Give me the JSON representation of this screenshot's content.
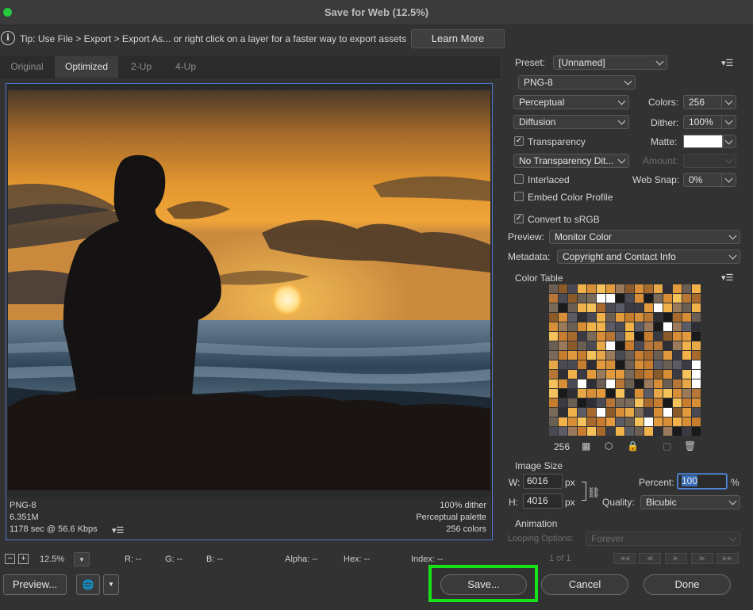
{
  "window": {
    "title": "Save for Web (12.5%)"
  },
  "tip": {
    "text": "Tip: Use File > Export > Export As...  or right click on a layer for a faster way to export assets",
    "learn_more": "Learn More"
  },
  "tabs": [
    "Original",
    "Optimized",
    "2-Up",
    "4-Up"
  ],
  "active_tab": "Optimized",
  "preview_info": {
    "format": "PNG-8",
    "size": "6.351M",
    "time": "1178 sec @ 56.6 Kbps",
    "dither": "100% dither",
    "palette": "Perceptual palette",
    "colors": "256 colors"
  },
  "status": {
    "zoom": "12.5%",
    "r": "R: --",
    "g": "G: --",
    "b": "B: --",
    "alpha": "Alpha: --",
    "hex": "Hex: --",
    "index": "Index: --"
  },
  "buttons": {
    "preview": "Preview...",
    "save": "Save...",
    "cancel": "Cancel",
    "done": "Done"
  },
  "settings": {
    "preset_label": "Preset:",
    "preset_value": "[Unnamed]",
    "format": "PNG-8",
    "reduction": "Perceptual",
    "colors_label": "Colors:",
    "colors_value": "256",
    "dither_algo": "Diffusion",
    "dither_label": "Dither:",
    "dither_value": "100%",
    "transparency_label": "Transparency",
    "transparency_checked": true,
    "matte_label": "Matte:",
    "transparency_dither": "No Transparency Dit...",
    "amount_label": "Amount:",
    "interlaced_label": "Interlaced",
    "interlaced_checked": false,
    "websnap_label": "Web Snap:",
    "websnap_value": "0%",
    "embed_label": "Embed Color Profile",
    "embed_checked": false,
    "srgb_label": "Convert to sRGB",
    "srgb_checked": true,
    "preview_label": "Preview:",
    "preview_value": "Monitor Color",
    "metadata_label": "Metadata:",
    "metadata_value": "Copyright and Contact Info"
  },
  "color_table": {
    "title": "Color Table",
    "count": "256"
  },
  "image_size": {
    "title": "Image Size",
    "w_label": "W:",
    "w_value": "6016",
    "h_label": "H:",
    "h_value": "4016",
    "unit": "px",
    "percent_label": "Percent:",
    "percent_value": "100",
    "percent_unit": "%",
    "quality_label": "Quality:",
    "quality_value": "Bicubic"
  },
  "animation": {
    "title": "Animation",
    "looping_label": "Looping Options:",
    "looping_value": "Forever",
    "frame": "1 of 1"
  },
  "colors": {
    "accent_highlight": "#19e119",
    "preview_border": "#4e7ad1"
  }
}
